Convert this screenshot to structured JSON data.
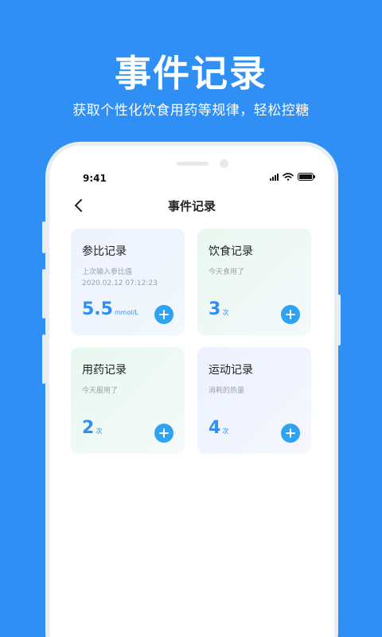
{
  "promo": {
    "title": "事件记录",
    "subtitle": "获取个性化饮食用药等规律，轻松控糖"
  },
  "status_bar": {
    "time": "9:41",
    "icons": [
      "signal-icon",
      "wifi-icon",
      "battery-icon"
    ]
  },
  "nav": {
    "title": "事件记录",
    "back_icon": "chevron-left-icon"
  },
  "cards": [
    {
      "title": "参比记录",
      "sub": "上次输入参比值",
      "sub2": "2020.02.12 07:12:23",
      "value": "5.5",
      "unit": "mmol/L"
    },
    {
      "title": "饮食记录",
      "sub": "今天食用了",
      "value": "3",
      "unit": "次"
    },
    {
      "title": "用药记录",
      "sub": "今天服用了",
      "value": "2",
      "unit": "次"
    },
    {
      "title": "运动记录",
      "sub": "消耗的热量",
      "value": "4",
      "unit": "次"
    }
  ],
  "colors": {
    "background": "#2F8FF4",
    "accent": "#2F8FF4",
    "add_button": "#2FA3F2"
  }
}
